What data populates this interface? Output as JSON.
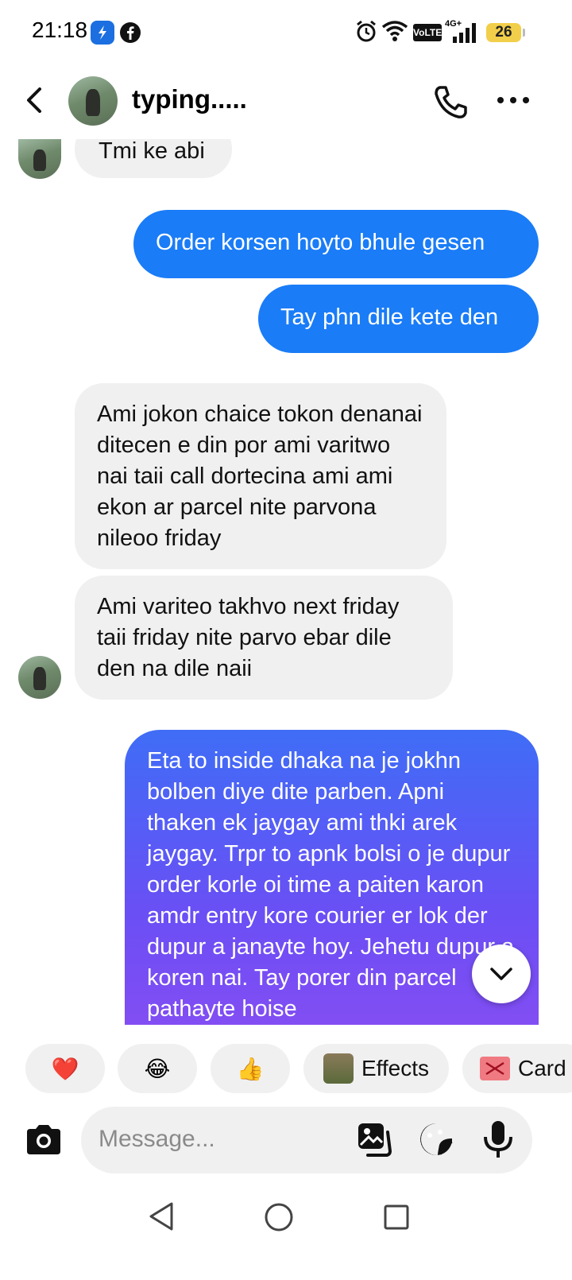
{
  "status_bar": {
    "time": "21:18",
    "battery": "26",
    "icons": [
      "app-icon",
      "facebook-icon",
      "alarm-icon",
      "wifi-icon",
      "volte-icon",
      "signal-icon",
      "battery-icon"
    ],
    "volte_label": "VoLTE",
    "network_label": "4G+"
  },
  "header": {
    "title": "typing.....",
    "icons": [
      "back-icon",
      "avatar",
      "phone-icon",
      "more-icon"
    ]
  },
  "messages": [
    {
      "from": "them",
      "text": "Tmi ke abi"
    },
    {
      "from": "me",
      "text": "Order korsen hoyto bhule gesen"
    },
    {
      "from": "me",
      "text": "Tay phn dile kete den"
    },
    {
      "from": "them",
      "text": "Ami jokon chaice tokon denanai ditecen e din por ami varitwo nai taii call dortecina ami ami ekon ar parcel nite parvona nileoo friday"
    },
    {
      "from": "them",
      "text": "Ami variteo takhvo next friday taii friday nite parvo ebar dile den na dile naii"
    },
    {
      "from": "me",
      "text": "Eta to inside dhaka na je jokhn bolben diye dite parben. Apni thaken ek jaygay ami thki arek jaygay. Trpr to apnk bolsi o je dupur order korle oi time a paiten karon amdr entry kore courier er lok der dupur a janayte hoy. Jehetu dupur a koren nai. Tay porer din parcel pathayte hoise"
    }
  ],
  "reactions": [
    {
      "emoji": "❤️",
      "name": "heart"
    },
    {
      "emoji": "😂",
      "name": "laughing"
    },
    {
      "emoji": "👍",
      "name": "thumbs-up"
    },
    {
      "label": "Effects"
    },
    {
      "label": "Card"
    }
  ],
  "composer": {
    "placeholder": "Message...",
    "icons": [
      "camera-icon",
      "gallery-icon",
      "sticker-icon",
      "mic-icon"
    ]
  },
  "nav": [
    "back-nav-icon",
    "home-nav-icon",
    "recents-nav-icon"
  ]
}
